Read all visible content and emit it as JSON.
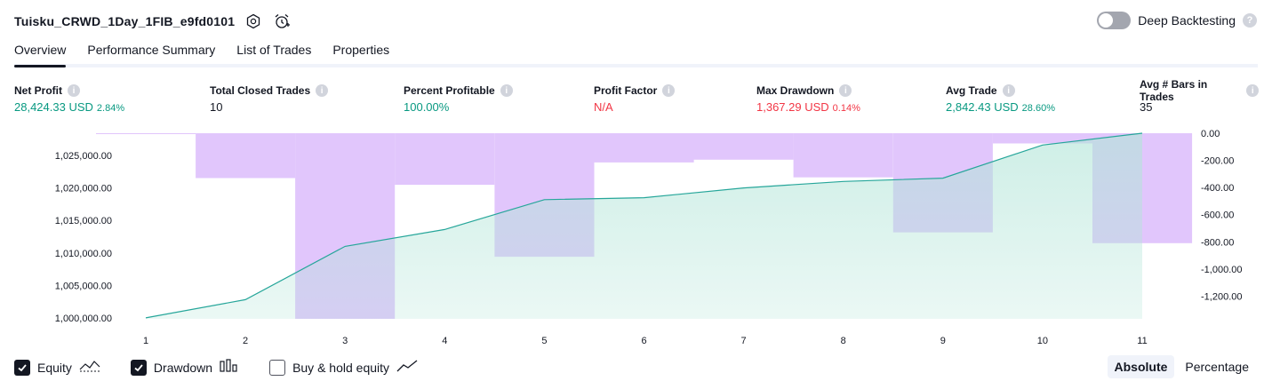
{
  "header": {
    "strategy_title": "Tuisku_CRWD_1Day_1FIB_e9fd0101",
    "deep_backtesting_label": "Deep Backtesting",
    "deep_backtesting_enabled": false,
    "help_glyph": "?"
  },
  "tabs": [
    {
      "label": "Overview",
      "active": true
    },
    {
      "label": "Performance Summary",
      "active": false
    },
    {
      "label": "List of Trades",
      "active": false
    },
    {
      "label": "Properties",
      "active": false
    }
  ],
  "metrics": {
    "net_profit": {
      "label": "Net Profit",
      "value": "28,424.33 USD",
      "pct": "2.84%"
    },
    "total_closed_trades": {
      "label": "Total Closed Trades",
      "value": "10"
    },
    "percent_profitable": {
      "label": "Percent Profitable",
      "value": "100.00%"
    },
    "profit_factor": {
      "label": "Profit Factor",
      "value": "N/A"
    },
    "max_drawdown": {
      "label": "Max Drawdown",
      "value": "1,367.29 USD",
      "pct": "0.14%"
    },
    "avg_trade": {
      "label": "Avg Trade",
      "value": "2,842.43 USD",
      "pct": "28.60%"
    },
    "avg_bars": {
      "label": "Avg # Bars in Trades",
      "value": "35"
    },
    "info_glyph": "i"
  },
  "colors": {
    "positive": "#089981",
    "negative": "#f23645",
    "equity_line": "#26a69a",
    "equity_fill": "#b2e5d8",
    "drawdown_bar": "#e1c6fc",
    "overlap": "#b4b3e4"
  },
  "chart_data": {
    "type": "area",
    "x": [
      1,
      2,
      3,
      4,
      5,
      6,
      7,
      8,
      9,
      10,
      11
    ],
    "x_tick_labels": [
      "1",
      "2",
      "3",
      "4",
      "5",
      "6",
      "7",
      "8",
      "9",
      "10",
      "11"
    ],
    "left_axis": {
      "ticks": [
        "1,000,000.00",
        "1,005,000.00",
        "1,010,000.00",
        "1,015,000.00",
        "1,020,000.00",
        "1,025,000.00"
      ],
      "tick_values": [
        1000000,
        1005000,
        1010000,
        1015000,
        1020000,
        1025000
      ],
      "range": [
        999850,
        1028424
      ]
    },
    "right_axis": {
      "ticks": [
        "0.00",
        "-200.00",
        "-400.00",
        "-600.00",
        "-800.00",
        "-1,000.00",
        "-1,200.00"
      ],
      "tick_values": [
        0,
        -200,
        -400,
        -600,
        -800,
        -1000,
        -1200
      ],
      "range": [
        -1367,
        0
      ]
    },
    "series": [
      {
        "name": "Equity",
        "axis": "left",
        "values": [
          1000000,
          1002800,
          1011000,
          1013600,
          1018200,
          1018500,
          1020000,
          1021000,
          1021500,
          1026600,
          1028424
        ]
      },
      {
        "name": "Drawdown",
        "axis": "right",
        "bar_start": 0.5,
        "values": [
          -5,
          -330,
          -1367,
          -380,
          -910,
          -215,
          -195,
          -325,
          -730,
          -75,
          -810
        ]
      }
    ],
    "grid": false
  },
  "legend": [
    {
      "label": "Equity",
      "checked": true,
      "icon": "equity-line-icon"
    },
    {
      "label": "Drawdown",
      "checked": true,
      "icon": "drawdown-bars-icon"
    },
    {
      "label": "Buy & hold equity",
      "checked": false,
      "icon": "buy-hold-line-icon"
    }
  ],
  "mode": {
    "absolute_label": "Absolute",
    "percentage_label": "Percentage",
    "selected": "Absolute"
  }
}
